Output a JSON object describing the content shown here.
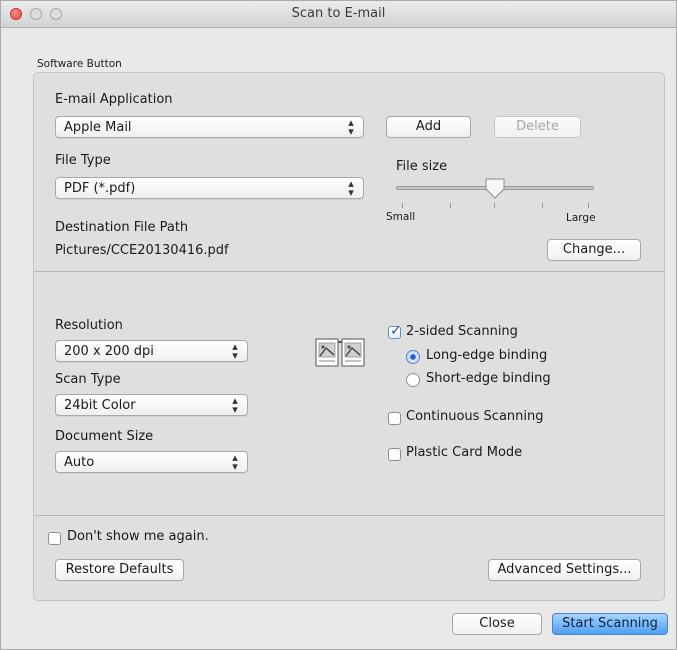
{
  "window": {
    "title": "Scan to E-mail"
  },
  "group": {
    "label": "Software Button"
  },
  "email_app": {
    "label": "E-mail Application",
    "value": "Apple Mail",
    "add_label": "Add",
    "delete_label": "Delete"
  },
  "file_type": {
    "label": "File Type",
    "value": "PDF (*.pdf)"
  },
  "file_size": {
    "label": "File size",
    "min_label": "Small",
    "max_label": "Large",
    "level": 0.5
  },
  "destination": {
    "label": "Destination File Path",
    "path": "Pictures/CCE20130416.pdf",
    "change_label": "Change..."
  },
  "resolution": {
    "label": "Resolution",
    "value": "200 x 200 dpi"
  },
  "scan_type": {
    "label": "Scan Type",
    "value": "24bit Color"
  },
  "document_size": {
    "label": "Document Size",
    "value": "Auto"
  },
  "two_sided": {
    "label": "2-sided Scanning",
    "checked": true,
    "long_edge_label": "Long-edge binding",
    "short_edge_label": "Short-edge binding"
  },
  "continuous": {
    "label": "Continuous Scanning",
    "checked": false
  },
  "plastic_card": {
    "label": "Plastic Card Mode",
    "checked": false
  },
  "dont_show": {
    "label": "Don't show me again.",
    "checked": false
  },
  "buttons": {
    "restore": "Restore Defaults",
    "advanced": "Advanced Settings...",
    "close": "Close",
    "start": "Start Scanning"
  },
  "icons": {
    "popup_arrow": "up-down-chevron-icon",
    "scan_binding": "two-page-binding-icon"
  },
  "colors": {
    "accent": "#4d9ff4",
    "checkmark": "#1e54b6"
  }
}
